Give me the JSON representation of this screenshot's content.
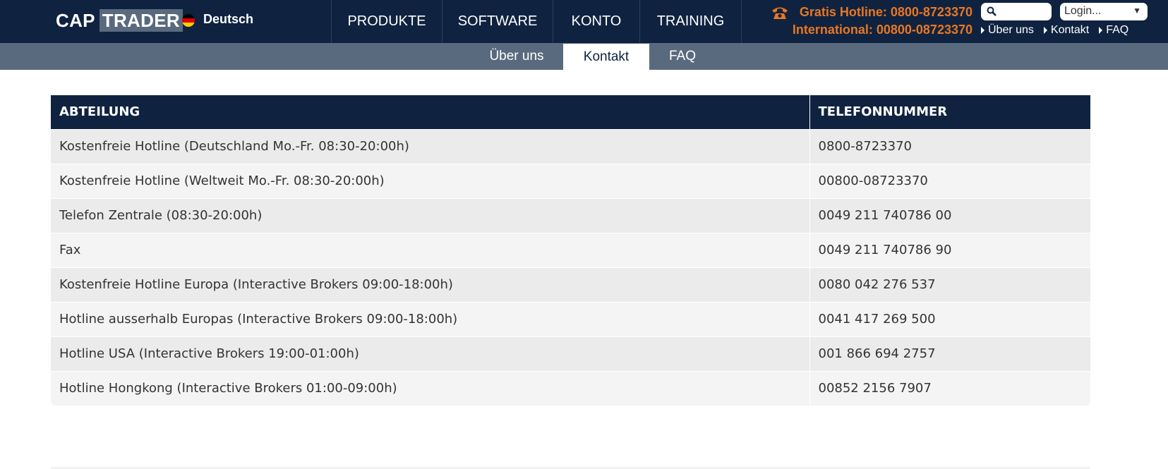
{
  "brand": {
    "part1": "CAP",
    "part2": "TRADER",
    "language": "Deutsch"
  },
  "main_nav": [
    {
      "label": "PRODUKTE"
    },
    {
      "label": "SOFTWARE"
    },
    {
      "label": "KONTO"
    },
    {
      "label": "TRAINING"
    }
  ],
  "hotline": {
    "gratis": "Gratis Hotline: 0800-8723370",
    "international": "International: 00800-08723370"
  },
  "search": {
    "placeholder": ""
  },
  "login": {
    "label": "Login..."
  },
  "top_links": [
    {
      "label": "Über uns"
    },
    {
      "label": "Kontakt"
    },
    {
      "label": "FAQ"
    }
  ],
  "sub_nav": [
    {
      "label": "Über uns",
      "active": false
    },
    {
      "label": "Kontakt",
      "active": true
    },
    {
      "label": "FAQ",
      "active": false
    }
  ],
  "table": {
    "headers": [
      "ABTEILUNG",
      "TELEFONNUMMER"
    ],
    "rows": [
      [
        "Kostenfreie Hotline (Deutschland Mo.-Fr. 08:30-20:00h)",
        "0800-8723370"
      ],
      [
        "Kostenfreie Hotline (Weltweit Mo.-Fr. 08:30-20:00h)",
        "00800-08723370"
      ],
      [
        "Telefon Zentrale (08:30-20:00h)",
        "0049 211 740786 00"
      ],
      [
        "Fax",
        "0049 211 740786 90"
      ],
      [
        "Kostenfreie Hotline Europa (Interactive Brokers 09:00-18:00h)",
        "0080 042 276 537"
      ],
      [
        "Hotline ausserhalb Europas (Interactive Brokers 09:00-18:00h)",
        "0041 417 269 500"
      ],
      [
        "Hotline USA (Interactive Brokers 19:00-01:00h)",
        "001 866 694 2757"
      ],
      [
        "Hotline Hongkong (Interactive Brokers 01:00-09:00h)",
        "00852 2156 7907"
      ]
    ]
  },
  "colors": {
    "navy": "#0f2340",
    "slate": "#5a6a7e",
    "accent_orange": "#e87722"
  },
  "icons": {
    "phone": "phone-icon",
    "search": "search-icon",
    "flag": "flag-germany-icon"
  }
}
